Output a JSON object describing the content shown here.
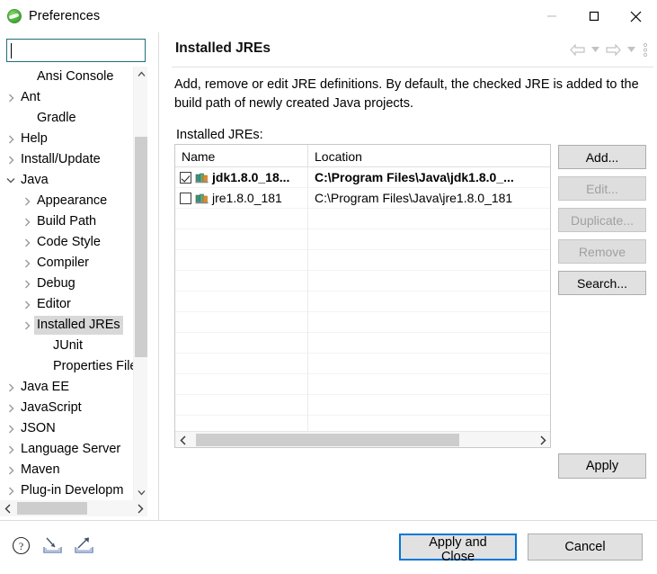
{
  "window": {
    "title": "Preferences",
    "icon": "eclipse-icon",
    "controls": {
      "minimize": "minimize-icon",
      "maximize": "maximize-icon",
      "close": "close-icon"
    }
  },
  "sidebar": {
    "filter": {
      "value": "",
      "placeholder": ""
    },
    "items": [
      {
        "label": "Ansi Console",
        "indent": 1,
        "arrow": "none",
        "selected": false
      },
      {
        "label": "Ant",
        "indent": 0,
        "arrow": "collapsed",
        "selected": false
      },
      {
        "label": "Gradle",
        "indent": 1,
        "arrow": "none",
        "selected": false
      },
      {
        "label": "Help",
        "indent": 0,
        "arrow": "collapsed",
        "selected": false
      },
      {
        "label": "Install/Update",
        "indent": 0,
        "arrow": "collapsed",
        "selected": false
      },
      {
        "label": "Java",
        "indent": 0,
        "arrow": "expanded",
        "selected": false
      },
      {
        "label": "Appearance",
        "indent": 1,
        "arrow": "collapsed",
        "selected": false
      },
      {
        "label": "Build Path",
        "indent": 1,
        "arrow": "collapsed",
        "selected": false
      },
      {
        "label": "Code Style",
        "indent": 1,
        "arrow": "collapsed",
        "selected": false
      },
      {
        "label": "Compiler",
        "indent": 1,
        "arrow": "collapsed",
        "selected": false
      },
      {
        "label": "Debug",
        "indent": 1,
        "arrow": "collapsed",
        "selected": false
      },
      {
        "label": "Editor",
        "indent": 1,
        "arrow": "collapsed",
        "selected": false
      },
      {
        "label": "Installed JREs",
        "indent": 1,
        "arrow": "collapsed",
        "selected": true
      },
      {
        "label": "JUnit",
        "indent": 2,
        "arrow": "none",
        "selected": false
      },
      {
        "label": "Properties File",
        "indent": 2,
        "arrow": "none",
        "selected": false
      },
      {
        "label": "Java EE",
        "indent": 0,
        "arrow": "collapsed",
        "selected": false
      },
      {
        "label": "JavaScript",
        "indent": 0,
        "arrow": "collapsed",
        "selected": false
      },
      {
        "label": "JSON",
        "indent": 0,
        "arrow": "collapsed",
        "selected": false
      },
      {
        "label": "Language Server",
        "indent": 0,
        "arrow": "collapsed",
        "selected": false
      },
      {
        "label": "Maven",
        "indent": 0,
        "arrow": "collapsed",
        "selected": false
      },
      {
        "label": "Plug-in Developm",
        "indent": 0,
        "arrow": "collapsed",
        "selected": false
      }
    ]
  },
  "page": {
    "title": "Installed JREs",
    "description": "Add, remove or edit JRE definitions. By default, the checked JRE is added to the build path of newly created Java projects.",
    "list_label": "Installed JREs:",
    "nav": {
      "back": "back-arrow-icon",
      "back_menu": "chevron-down-icon",
      "forward": "forward-arrow-icon",
      "forward_menu": "chevron-down-icon",
      "view_menu": "vertical-dots-icon"
    }
  },
  "table": {
    "columns": [
      "Name",
      "Location"
    ],
    "rows": [
      {
        "checked": true,
        "bold": true,
        "name": "jdk1.8.0_18...",
        "location": "C:\\Program Files\\Java\\jdk1.8.0_..."
      },
      {
        "checked": false,
        "bold": false,
        "name": "jre1.8.0_181",
        "location": "C:\\Program Files\\Java\\jre1.8.0_181"
      }
    ],
    "scrollbar": {
      "left_arrow": "chevron-left-icon",
      "right_arrow": "chevron-right-icon"
    }
  },
  "side_buttons": [
    {
      "label": "Add...",
      "enabled": true
    },
    {
      "label": "Edit...",
      "enabled": false
    },
    {
      "label": "Duplicate...",
      "enabled": false
    },
    {
      "label": "Remove",
      "enabled": false
    },
    {
      "label": "Search...",
      "enabled": true
    }
  ],
  "apply_button": {
    "label": "Apply"
  },
  "bottom": {
    "icons": [
      {
        "name": "help-icon"
      },
      {
        "name": "import-icon"
      },
      {
        "name": "export-icon"
      }
    ],
    "buttons": [
      {
        "label": "Apply and Close",
        "default": true
      },
      {
        "label": "Cancel",
        "default": false
      }
    ]
  },
  "colors": {
    "accent": "#0078d7",
    "button_face": "#e1e1e1",
    "selection": "#d8d8d8",
    "filter_border": "#1f6f7a",
    "scroll_thumb": "#cdcdcd"
  }
}
